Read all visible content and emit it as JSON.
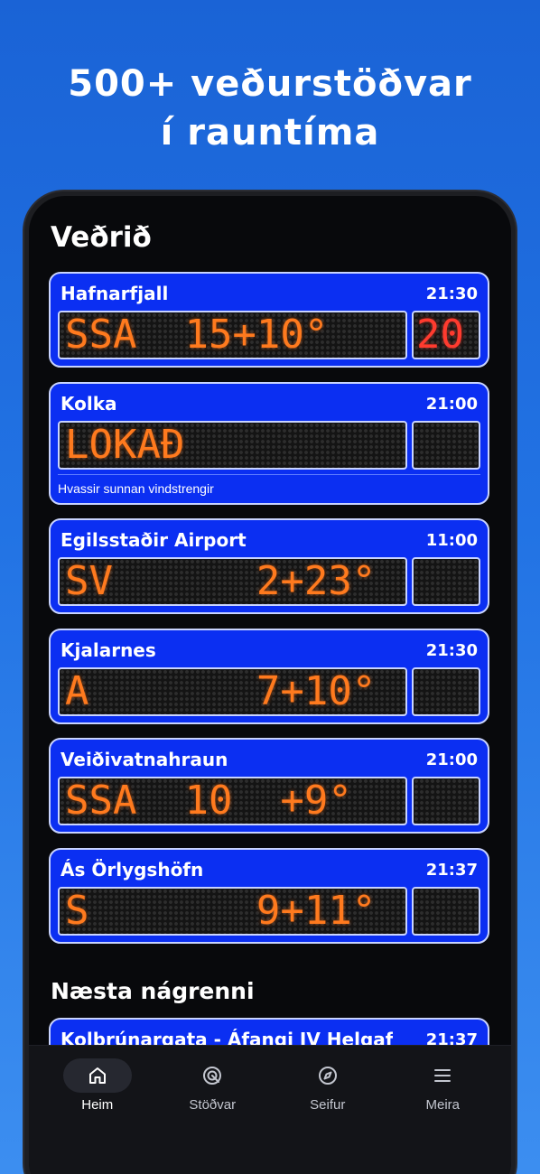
{
  "headline": {
    "line1": "500+ veðurstöðvar",
    "line2": "í rauntíma"
  },
  "app": {
    "title": "Veðrið"
  },
  "stations": [
    {
      "name": "Hafnarfjall",
      "time": "21:30",
      "display": "SSA  15+10°",
      "gust": "20",
      "note": ""
    },
    {
      "name": "Kolka",
      "time": "21:00",
      "display": "LOKAÐ",
      "gust": "",
      "note": "Hvassir sunnan vindstrengir"
    },
    {
      "name": "Egilsstaðir Airport",
      "time": "11:00",
      "display": "SV      2+23°",
      "gust": "",
      "note": ""
    },
    {
      "name": "Kjalarnes",
      "time": "21:30",
      "display": "A       7+10°",
      "gust": "",
      "note": ""
    },
    {
      "name": "Veiðivatnahraun",
      "time": "21:00",
      "display": "SSA  10  +9°",
      "gust": "",
      "note": ""
    },
    {
      "name": "Ás Örlygshöfn",
      "time": "21:37",
      "display": "S       9+11°",
      "gust": "",
      "note": ""
    }
  ],
  "nearby": {
    "title": "Næsta nágrenni",
    "stations": [
      {
        "name": "Kolbrúnargata - Áfangi IV Helgaf",
        "time": "21:37"
      }
    ]
  },
  "tabs": [
    {
      "label": "Heim",
      "icon": "home-icon",
      "active": true
    },
    {
      "label": "Stöðvar",
      "icon": "radar-icon",
      "active": false
    },
    {
      "label": "Seifur",
      "icon": "compass-icon",
      "active": false
    },
    {
      "label": "Meira",
      "icon": "menu-icon",
      "active": false
    }
  ],
  "colors": {
    "background": "#2273e4",
    "card": "#0b2ff2",
    "led_orange": "#ff7a1e",
    "led_red": "#ff3b2f"
  }
}
